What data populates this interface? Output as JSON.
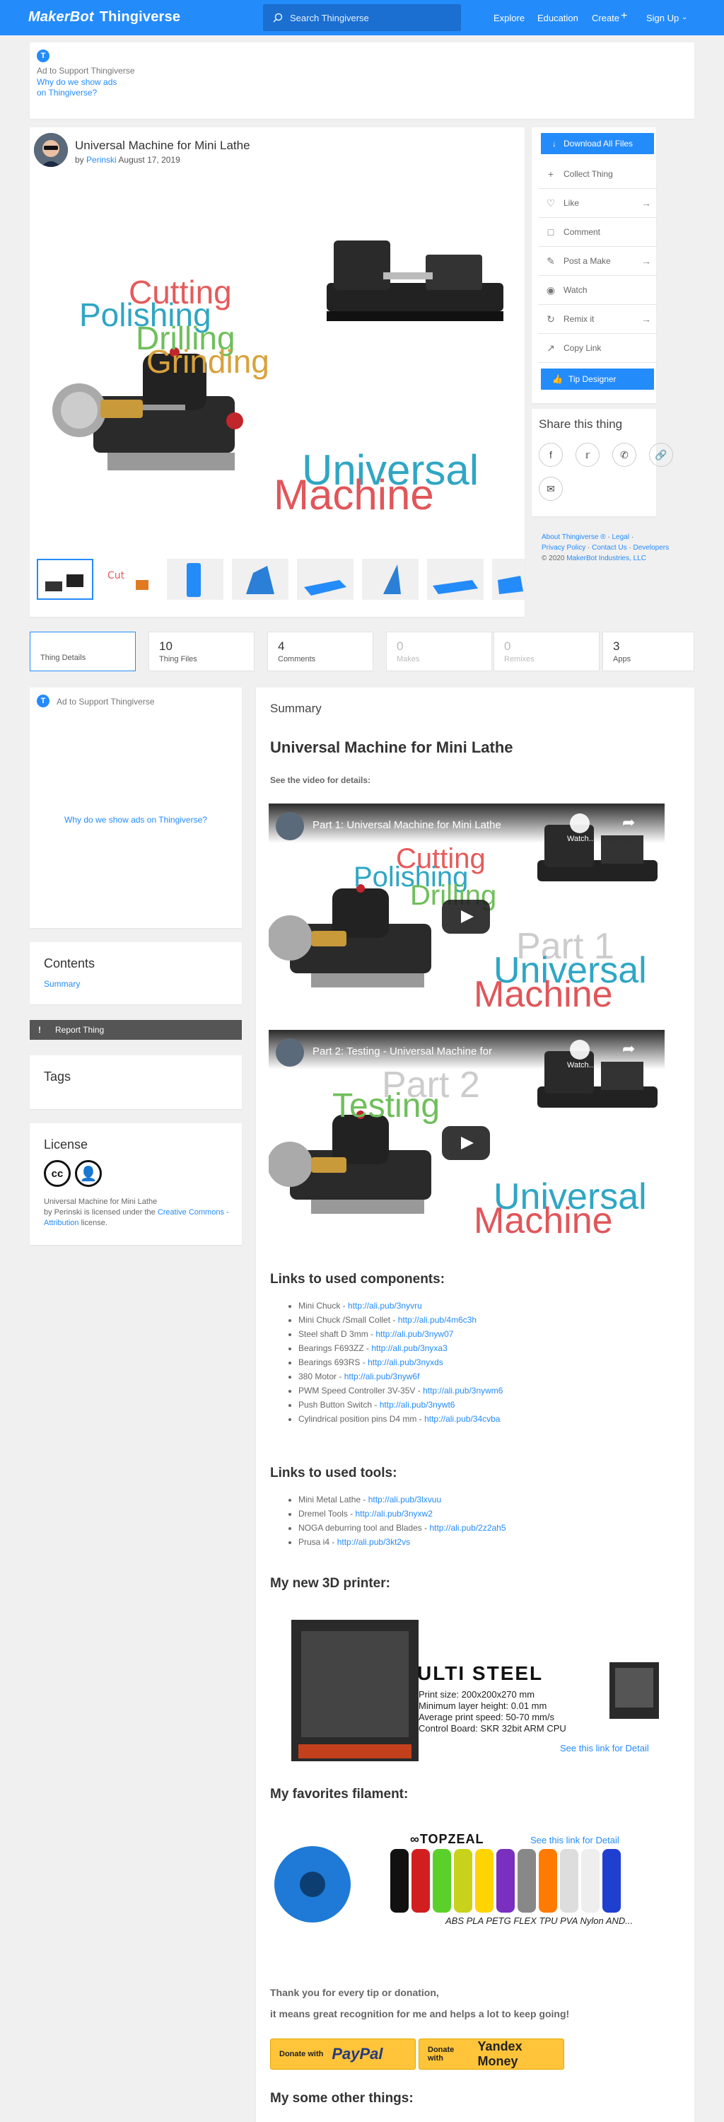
{
  "header": {
    "logo_brand": "MakerBot",
    "logo_product": "Thingiverse",
    "search_placeholder": "Search Thingiverse",
    "nav": [
      "Explore",
      "Education",
      "Create",
      "Sign Up"
    ]
  },
  "top_ad": {
    "label": "Ad to Support Thingiverse",
    "why_line1": "Why do we show ads",
    "why_line2": "on Thingiverse?"
  },
  "thing": {
    "title": "Universal Machine for Mini Lathe",
    "by": "by",
    "author": "Perinski",
    "date": "August 17, 2019",
    "hero_words": [
      "Cutting",
      "Polishing",
      "Drilling",
      "Grinding"
    ],
    "hero_brand1": "Universal",
    "hero_brand2": "Machine",
    "thumbnails": 8
  },
  "actions": {
    "download": "Download All Files",
    "items": [
      {
        "label": "Collect Thing",
        "icon": "plus-icon",
        "arrow": false
      },
      {
        "label": "Like",
        "icon": "heart-icon",
        "arrow": true
      },
      {
        "label": "Comment",
        "icon": "comment-icon",
        "arrow": false
      },
      {
        "label": "Post a Make",
        "icon": "make-icon",
        "arrow": true
      },
      {
        "label": "Watch",
        "icon": "eye-icon",
        "arrow": false
      },
      {
        "label": "Remix it",
        "icon": "remix-icon",
        "arrow": true
      },
      {
        "label": "Copy Link",
        "icon": "link-icon",
        "arrow": false
      }
    ],
    "tip": "Tip Designer"
  },
  "share": {
    "title": "Share this thing"
  },
  "footer_links": {
    "line1": [
      "About Thingiverse ®",
      "Legal"
    ],
    "line2": [
      "Privacy Policy",
      "Contact Us",
      "Developers"
    ],
    "copyright": "© 2020",
    "company": "MakerBot Industries, LLC"
  },
  "tabs": [
    {
      "num": "",
      "label": "Thing Details"
    },
    {
      "num": "10",
      "label": "Thing Files"
    },
    {
      "num": "4",
      "label": "Comments"
    },
    {
      "num": "0",
      "label": "Makes"
    },
    {
      "num": "0",
      "label": "Remixes"
    },
    {
      "num": "3",
      "label": "Apps"
    }
  ],
  "side": {
    "ad_label": "Ad to Support Thingiverse",
    "ad_why": "Why do we show ads on Thingiverse?",
    "contents_title": "Contents",
    "contents_link": "Summary",
    "report": "Report Thing",
    "tags_title": "Tags",
    "license_title": "License",
    "license_line1": "Universal Machine for Mini Lathe",
    "license_by": "by Perinski is licensed under the",
    "license_link": "Creative Commons - Attribution",
    "license_end": "license."
  },
  "main": {
    "summary": "Summary",
    "title": "Universal Machine for Mini Lathe",
    "see_video": "See the video for details:",
    "video1_title": "Part 1: Universal Machine for Mini Lathe",
    "video1_words": [
      "Cutting",
      "Polishing",
      "Drilling",
      "Part 1",
      "Universal",
      "Machine"
    ],
    "video2_title": "Part 2: Testing - Universal Machine for",
    "video2_words": [
      "Part 2",
      "Testing",
      "Universal",
      "Machine"
    ],
    "watch_later": "Watch...",
    "components_title": "Links to used components:",
    "components": [
      {
        "text": "Mini Chuck - ",
        "link": "http://ali.pub/3nyvru"
      },
      {
        "text": "Mini Chuck /Small Collet - ",
        "link": "http://ali.pub/4m6c3h"
      },
      {
        "text": "Steel shaft D 3mm - ",
        "link": "http://ali.pub/3nyw07"
      },
      {
        "text": "Bearings F693ZZ - ",
        "link": "http://ali.pub/3nyxa3"
      },
      {
        "text": "Bearings 693RS - ",
        "link": "http://ali.pub/3nyxds"
      },
      {
        "text": "380 Motor - ",
        "link": "http://ali.pub/3nyw6f"
      },
      {
        "text": "PWM Speed Controller 3V-35V - ",
        "link": "http://ali.pub/3nywm6"
      },
      {
        "text": "Push Button Switch - ",
        "link": "http://ali.pub/3nywt6"
      },
      {
        "text": "Cylindrical position pins D4 mm - ",
        "link": "http://ali.pub/34cvba"
      }
    ],
    "tools_title": "Links to used tools:",
    "tools": [
      {
        "text": "Mini Metal Lathe - ",
        "link": "http://ali.pub/3lxvuu"
      },
      {
        "text": "Dremel Tools - ",
        "link": "http://ali.pub/3nyxw2"
      },
      {
        "text": "NOGA deburring tool and Blades - ",
        "link": "http://ali.pub/2z2ah5"
      },
      {
        "text": "Prusa i4 - ",
        "link": "http://ali.pub/3kt2vs"
      }
    ],
    "printer_title": "My new 3D printer:",
    "printer": {
      "brand": "ULTI STEEL",
      "specs": [
        "Print size: 200x200x270 mm",
        "Minimum layer height: 0.01 mm",
        "Average print speed: 50-70 mm/s",
        "Control Board: SKR 32bit ARM CPU"
      ],
      "link": "See this link for Detail"
    },
    "filament_title": "My favorites filament:",
    "filament": {
      "brand": "TOPZEAL",
      "link": "See this link for Detail",
      "types": "ABS PLA PETG FLEX TPU PVA Nylon AND..."
    },
    "thanks1": "Thank you for every tip or donation,",
    "thanks2": "it means great recognition for me and helps a lot to keep going!",
    "donate_with": "Donate with",
    "paypal": "PayPal",
    "yandex": "Yandex Money",
    "other_title": "My some other things:"
  },
  "colors": {
    "accent": "#248bfb",
    "report_bg": "#555555"
  }
}
